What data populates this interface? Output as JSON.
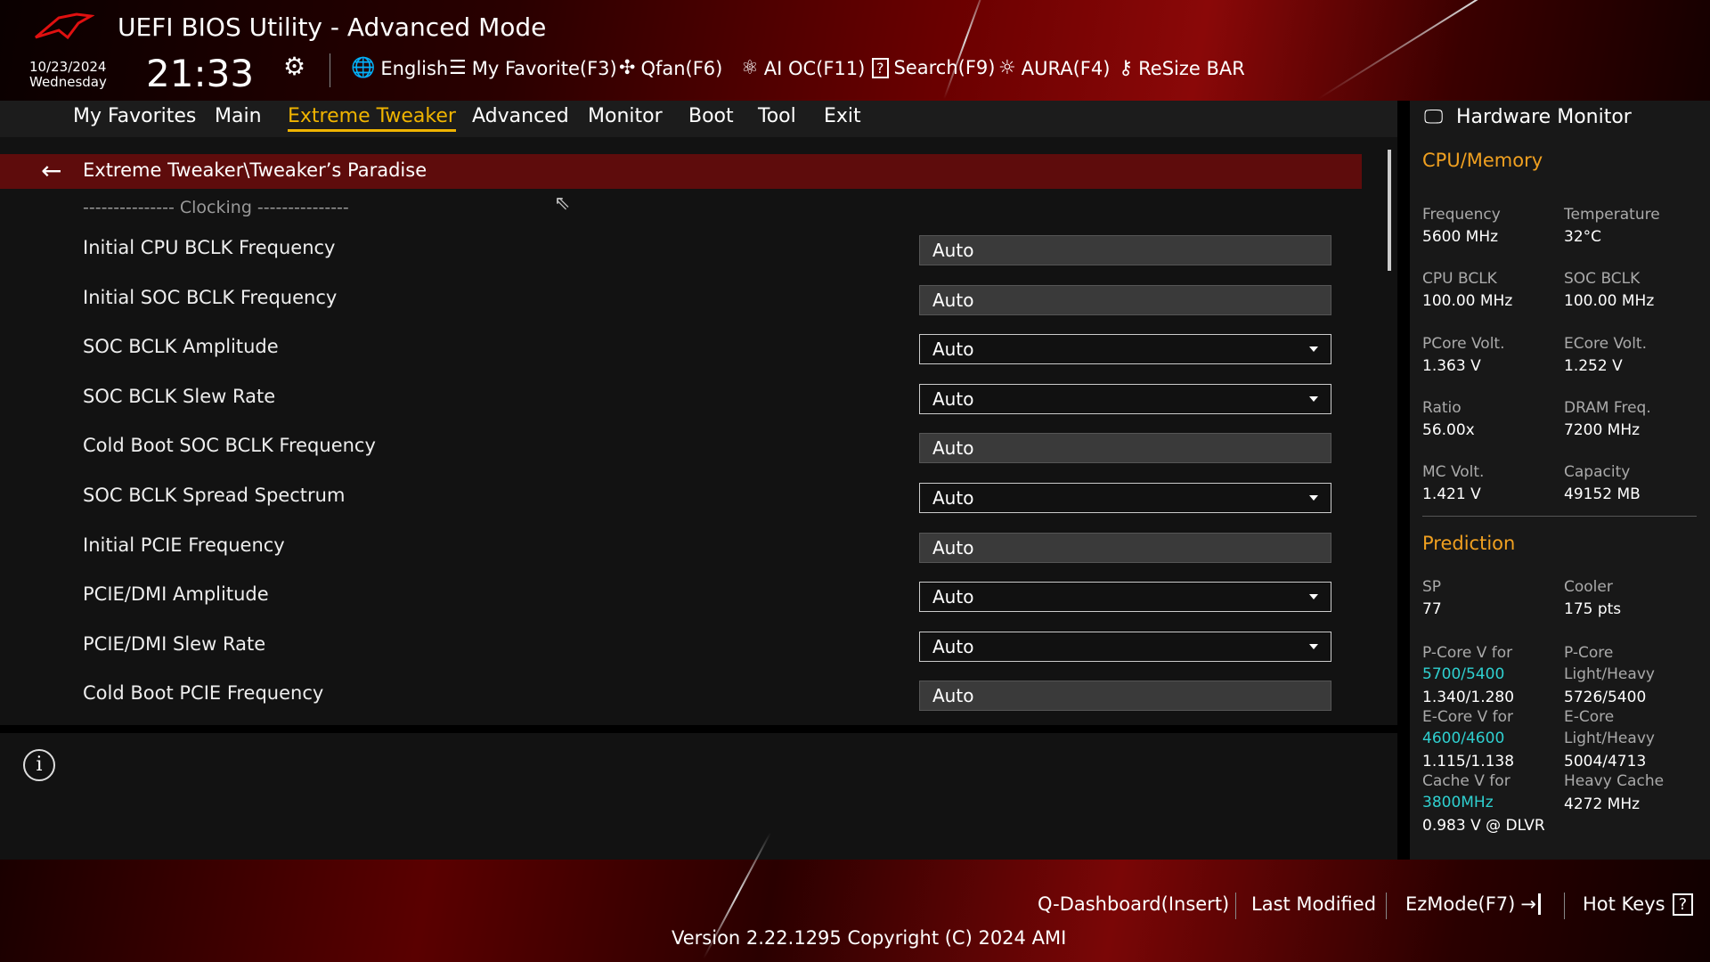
{
  "header": {
    "title": "UEFI BIOS Utility - Advanced Mode",
    "date": "10/23/2024",
    "weekday": "Wednesday",
    "time": "21:33"
  },
  "toolbar": [
    {
      "icon": "globe-icon",
      "label": "English"
    },
    {
      "icon": "favorite-icon",
      "label": "My Favorite(F3)"
    },
    {
      "icon": "fan-icon",
      "label": "Qfan(F6)"
    },
    {
      "icon": "ai-oc-icon",
      "label": "AI OC(F11)"
    },
    {
      "icon": "search-icon",
      "label": "Search(F9)"
    },
    {
      "icon": "aura-icon",
      "label": "AURA(F4)"
    },
    {
      "icon": "resize-bar-icon",
      "label": "ReSize BAR"
    }
  ],
  "nav": [
    "My Favorites",
    "Main",
    "Extreme Tweaker",
    "Advanced",
    "Monitor",
    "Boot",
    "Tool",
    "Exit"
  ],
  "breadcrumb": "Extreme Tweaker\\Tweaker’s Paradise",
  "section": "--------------- Clocking ---------------",
  "settings": [
    {
      "label": "Initial CPU BCLK Frequency",
      "value": "Auto",
      "type": "input"
    },
    {
      "label": "Initial SOC BCLK Frequency",
      "value": "Auto",
      "type": "input"
    },
    {
      "label": "SOC BCLK Amplitude",
      "value": "Auto",
      "type": "dropdown"
    },
    {
      "label": "SOC BCLK Slew Rate",
      "value": "Auto",
      "type": "dropdown"
    },
    {
      "label": "Cold Boot SOC BCLK Frequency",
      "value": "Auto",
      "type": "input"
    },
    {
      "label": "SOC BCLK Spread Spectrum",
      "value": "Auto",
      "type": "dropdown"
    },
    {
      "label": "Initial PCIE Frequency",
      "value": "Auto",
      "type": "input"
    },
    {
      "label": "PCIE/DMI Amplitude",
      "value": "Auto",
      "type": "dropdown"
    },
    {
      "label": "PCIE/DMI Slew Rate",
      "value": "Auto",
      "type": "dropdown"
    },
    {
      "label": "Cold Boot PCIE Frequency",
      "value": "Auto",
      "type": "input"
    }
  ],
  "hw": {
    "title": "Hardware Monitor",
    "cpu_title": "CPU/Memory",
    "cpu": [
      {
        "l": "Frequency",
        "v": "5600 MHz"
      },
      {
        "l": "Temperature",
        "v": "32°C"
      },
      {
        "l": "CPU BCLK",
        "v": "100.00 MHz"
      },
      {
        "l": "SOC BCLK",
        "v": "100.00 MHz"
      },
      {
        "l": "PCore Volt.",
        "v": "1.363 V"
      },
      {
        "l": "ECore Volt.",
        "v": "1.252 V"
      },
      {
        "l": "Ratio",
        "v": "56.00x"
      },
      {
        "l": "DRAM Freq.",
        "v": "7200 MHz"
      },
      {
        "l": "MC Volt.",
        "v": "1.421 V"
      },
      {
        "l": "Capacity",
        "v": "49152 MB"
      }
    ],
    "pred_title": "Prediction",
    "sp": {
      "l": "SP",
      "v": "77"
    },
    "cooler": {
      "l": "Cooler",
      "v": "175 pts"
    },
    "pcore_v": {
      "l": "P-Core V for",
      "f": "5700/5400",
      "v": "1.340/1.280"
    },
    "pcore_lh": {
      "l1": "P-Core",
      "l2": "Light/Heavy",
      "v": "5726/5400"
    },
    "ecore_v": {
      "l": "E-Core V for",
      "f": "4600/4600",
      "v": "1.115/1.138"
    },
    "ecore_lh": {
      "l1": "E-Core",
      "l2": "Light/Heavy",
      "v": "5004/4713"
    },
    "cache_v": {
      "l": "Cache V for",
      "f": "3800MHz",
      "v": "0.983 V @ DLVR"
    },
    "heavy_cache": {
      "l": "Heavy Cache",
      "v": "4272 MHz"
    }
  },
  "footer": {
    "qdash": "Q-Dashboard(Insert)",
    "last": "Last Modified",
    "ez": "EzMode(F7)",
    "hot": "Hot Keys",
    "version": "Version 2.22.1295 Copyright (C) 2024 AMI"
  },
  "colors": {
    "accent": "#f0b400",
    "crumb": "#5e0c0c",
    "cyan": "#2fd0d0"
  }
}
